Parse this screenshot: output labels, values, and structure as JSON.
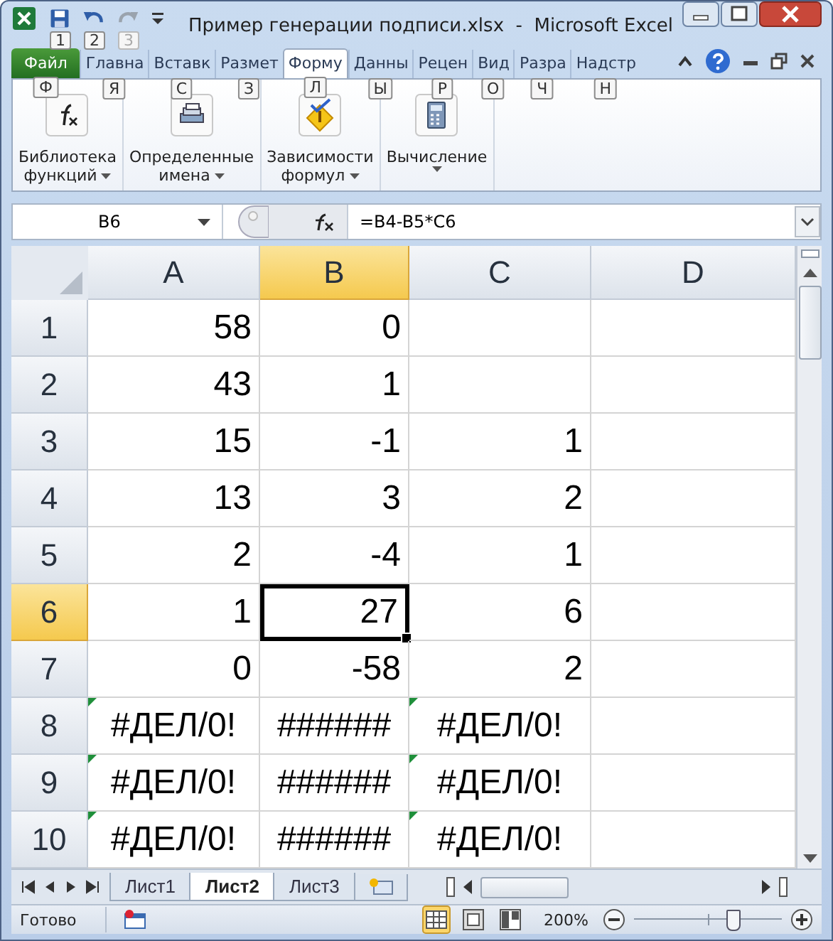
{
  "window": {
    "title": "Пример генерации подписи.xlsx  -  Microsoft Excel"
  },
  "quick_access": [
    {
      "kind": "save",
      "keytip": "1",
      "disabled": false
    },
    {
      "kind": "undo",
      "keytip": "2",
      "disabled": false
    },
    {
      "kind": "redo",
      "keytip": "3",
      "disabled": true
    }
  ],
  "ribbon_tabs": [
    {
      "label": "Файл",
      "kind": "file",
      "keytip": "Ф",
      "selected": false
    },
    {
      "label": "Главна",
      "kind": "tab",
      "keytip": "Я",
      "selected": false
    },
    {
      "label": "Вставк",
      "kind": "tab",
      "keytip": "С",
      "selected": false
    },
    {
      "label": "Размет",
      "kind": "tab",
      "keytip": "З",
      "selected": false
    },
    {
      "label": "Форму",
      "kind": "tab",
      "keytip": "Л",
      "selected": true
    },
    {
      "label": "Данны",
      "kind": "tab",
      "keytip": "Ы",
      "selected": false
    },
    {
      "label": "Рецен",
      "kind": "tab",
      "keytip": "Р",
      "selected": false
    },
    {
      "label": "Вид",
      "kind": "tab",
      "keytip": "О",
      "selected": false
    },
    {
      "label": "Разра",
      "kind": "tab",
      "keytip": "Ч",
      "selected": false
    },
    {
      "label": "Надстр",
      "kind": "tab",
      "keytip": "Н",
      "selected": false
    }
  ],
  "ribbon_groups": [
    {
      "kind": "function",
      "lines": [
        "Библиотека",
        "функций"
      ],
      "dropdown": true
    },
    {
      "kind": "names",
      "lines": [
        "Определенные",
        "имена"
      ],
      "dropdown": true
    },
    {
      "kind": "audit",
      "lines": [
        "Зависимости",
        "формул"
      ],
      "dropdown": true
    },
    {
      "kind": "calc",
      "lines": [
        "Вычисление"
      ],
      "dropdown": true
    }
  ],
  "formula_bar": {
    "name_box": "B6",
    "formula": "=B4-B5*C6"
  },
  "columns": [
    {
      "label": "A",
      "selected": false
    },
    {
      "label": "B",
      "selected": true
    },
    {
      "label": "C",
      "selected": false
    },
    {
      "label": "D",
      "selected": false
    }
  ],
  "rows": [
    {
      "label": "1",
      "selected": false,
      "cells": [
        {
          "kind": "number",
          "value": "58",
          "selected": false
        },
        {
          "kind": "number",
          "value": "0",
          "selected": false
        },
        {
          "kind": "empty",
          "selected": false
        },
        {
          "kind": "empty",
          "selected": false
        }
      ]
    },
    {
      "label": "2",
      "selected": false,
      "cells": [
        {
          "kind": "number",
          "value": "43",
          "selected": false
        },
        {
          "kind": "number",
          "value": "1",
          "selected": false
        },
        {
          "kind": "empty",
          "selected": false
        },
        {
          "kind": "empty",
          "selected": false
        }
      ]
    },
    {
      "label": "3",
      "selected": false,
      "cells": [
        {
          "kind": "number",
          "value": "15",
          "selected": false
        },
        {
          "kind": "number",
          "value": "-1",
          "selected": false
        },
        {
          "kind": "number",
          "value": "1",
          "selected": false
        },
        {
          "kind": "empty",
          "selected": false
        }
      ]
    },
    {
      "label": "4",
      "selected": false,
      "cells": [
        {
          "kind": "number",
          "value": "13",
          "selected": false
        },
        {
          "kind": "number",
          "value": "3",
          "selected": false
        },
        {
          "kind": "number",
          "value": "2",
          "selected": false
        },
        {
          "kind": "empty",
          "selected": false
        }
      ]
    },
    {
      "label": "5",
      "selected": false,
      "cells": [
        {
          "kind": "number",
          "value": "2",
          "selected": false
        },
        {
          "kind": "number",
          "value": "-4",
          "selected": false
        },
        {
          "kind": "number",
          "value": "1",
          "selected": false
        },
        {
          "kind": "empty",
          "selected": false
        }
      ]
    },
    {
      "label": "6",
      "selected": true,
      "cells": [
        {
          "kind": "number",
          "value": "1",
          "selected": false
        },
        {
          "kind": "number",
          "value": "27",
          "selected": true
        },
        {
          "kind": "number",
          "value": "6",
          "selected": false
        },
        {
          "kind": "empty",
          "selected": false
        }
      ]
    },
    {
      "label": "7",
      "selected": false,
      "cells": [
        {
          "kind": "number",
          "value": "0",
          "selected": false
        },
        {
          "kind": "number",
          "value": "-58",
          "selected": false
        },
        {
          "kind": "number",
          "value": "2",
          "selected": false
        },
        {
          "kind": "empty",
          "selected": false
        }
      ]
    },
    {
      "label": "8",
      "selected": false,
      "cells": [
        {
          "kind": "error",
          "value": "#ДЕЛ/0!",
          "flagged": true,
          "selected": false
        },
        {
          "kind": "error",
          "value": "######",
          "flagged": false,
          "selected": false
        },
        {
          "kind": "error",
          "value": "#ДЕЛ/0!",
          "flagged": true,
          "selected": false
        },
        {
          "kind": "empty",
          "selected": false
        }
      ]
    },
    {
      "label": "9",
      "selected": false,
      "cells": [
        {
          "kind": "error",
          "value": "#ДЕЛ/0!",
          "flagged": true,
          "selected": false
        },
        {
          "kind": "error",
          "value": "######",
          "flagged": false,
          "selected": false
        },
        {
          "kind": "error",
          "value": "#ДЕЛ/0!",
          "flagged": true,
          "selected": false
        },
        {
          "kind": "empty",
          "selected": false
        }
      ]
    },
    {
      "label": "10",
      "selected": false,
      "cells": [
        {
          "kind": "error",
          "value": "#ДЕЛ/0!",
          "flagged": true,
          "selected": false
        },
        {
          "kind": "error",
          "value": "######",
          "flagged": false,
          "selected": false
        },
        {
          "kind": "error",
          "value": "#ДЕЛ/0!",
          "flagged": true,
          "selected": false
        },
        {
          "kind": "empty",
          "selected": false
        }
      ]
    }
  ],
  "sheets": [
    {
      "label": "Лист1",
      "selected": false
    },
    {
      "label": "Лист2",
      "selected": true
    },
    {
      "label": "Лист3",
      "selected": false
    }
  ],
  "status_bar": {
    "text": "Готово",
    "views": [
      {
        "kind": "normal",
        "selected": true
      },
      {
        "kind": "page_layout",
        "selected": false
      },
      {
        "kind": "page_break",
        "selected": false
      }
    ],
    "zoom": "200%",
    "zoom_slider": {
      "level": 0.66
    }
  }
}
